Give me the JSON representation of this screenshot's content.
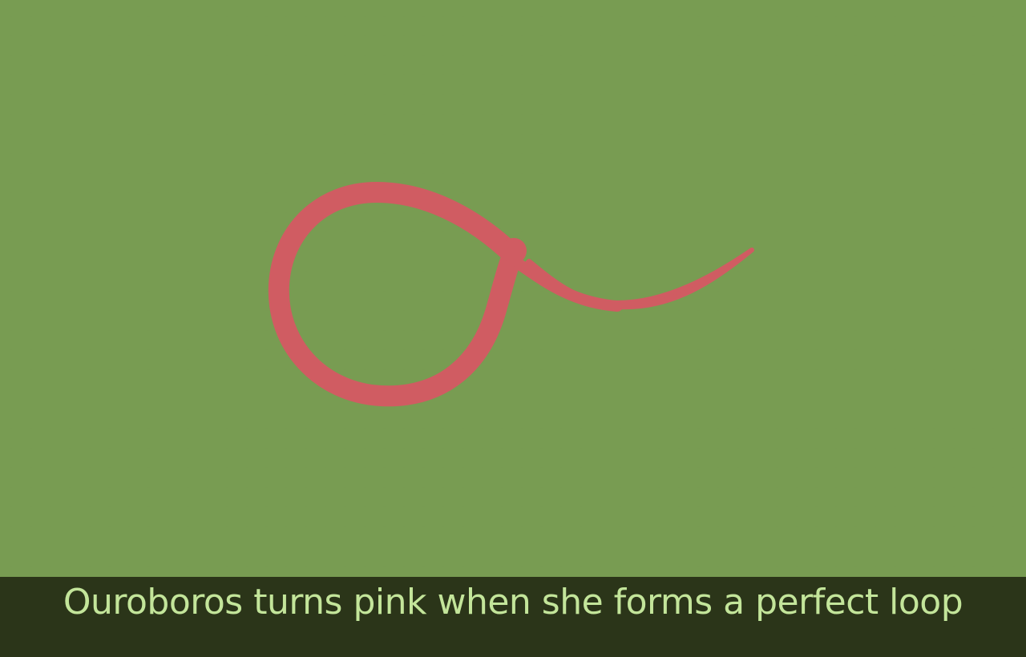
{
  "caption": {
    "text": "Ouroboros turns pink when she forms a perfect loop"
  },
  "colors": {
    "board_background": "#789c52",
    "dot": "#3f5b35",
    "snake": "#d05c62",
    "caption_background": "#2b3519",
    "caption_text": "#c3e59a"
  },
  "board": {
    "pattern": "dot-grid",
    "dot_style": "soft-blur"
  },
  "snake": {
    "state": "perfect-loop",
    "color_name": "pink"
  }
}
